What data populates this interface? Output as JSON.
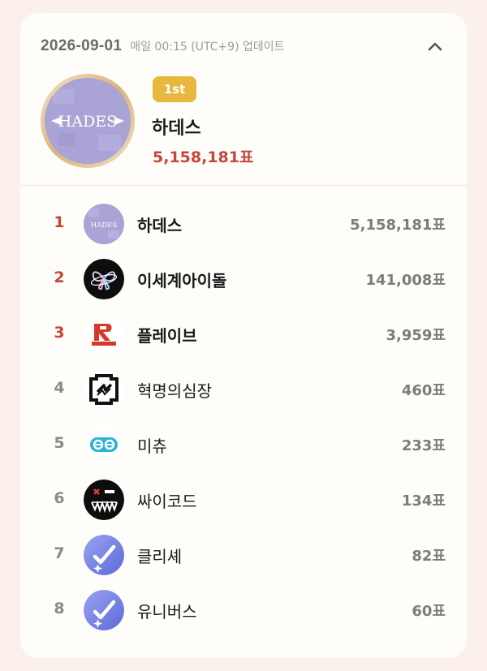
{
  "header": {
    "date": "2026-09-01",
    "update_text": "매일 00:15 (UTC+9) 업데이트"
  },
  "hero": {
    "badge": "1st",
    "name": "하데스",
    "votes": "5,158,181표",
    "logo_text": "HADES"
  },
  "ranking": [
    {
      "rank": "1",
      "name": "하데스",
      "votes": "5,158,181표",
      "logo": "hades-logo"
    },
    {
      "rank": "2",
      "name": "이세계아이돌",
      "votes": "141,008표",
      "logo": "isegye-idol-logo"
    },
    {
      "rank": "3",
      "name": "플레이브",
      "votes": "3,959표",
      "logo": "plave-logo"
    },
    {
      "rank": "4",
      "name": "혁명의심장",
      "votes": "460표",
      "logo": "revolution-heart-logo"
    },
    {
      "rank": "5",
      "name": "미츄",
      "votes": "233표",
      "logo": "michu-logo"
    },
    {
      "rank": "6",
      "name": "싸이코드",
      "votes": "134표",
      "logo": "psycode-logo"
    },
    {
      "rank": "7",
      "name": "클리셰",
      "votes": "82표",
      "logo": "cliche-logo"
    },
    {
      "rank": "8",
      "name": "유니버스",
      "votes": "60표",
      "logo": "universe-logo"
    }
  ],
  "colors": {
    "background": "#fbf0eb",
    "card": "#fffdf9",
    "top_rank": "#c6473a",
    "badge": "#e8b73d"
  }
}
